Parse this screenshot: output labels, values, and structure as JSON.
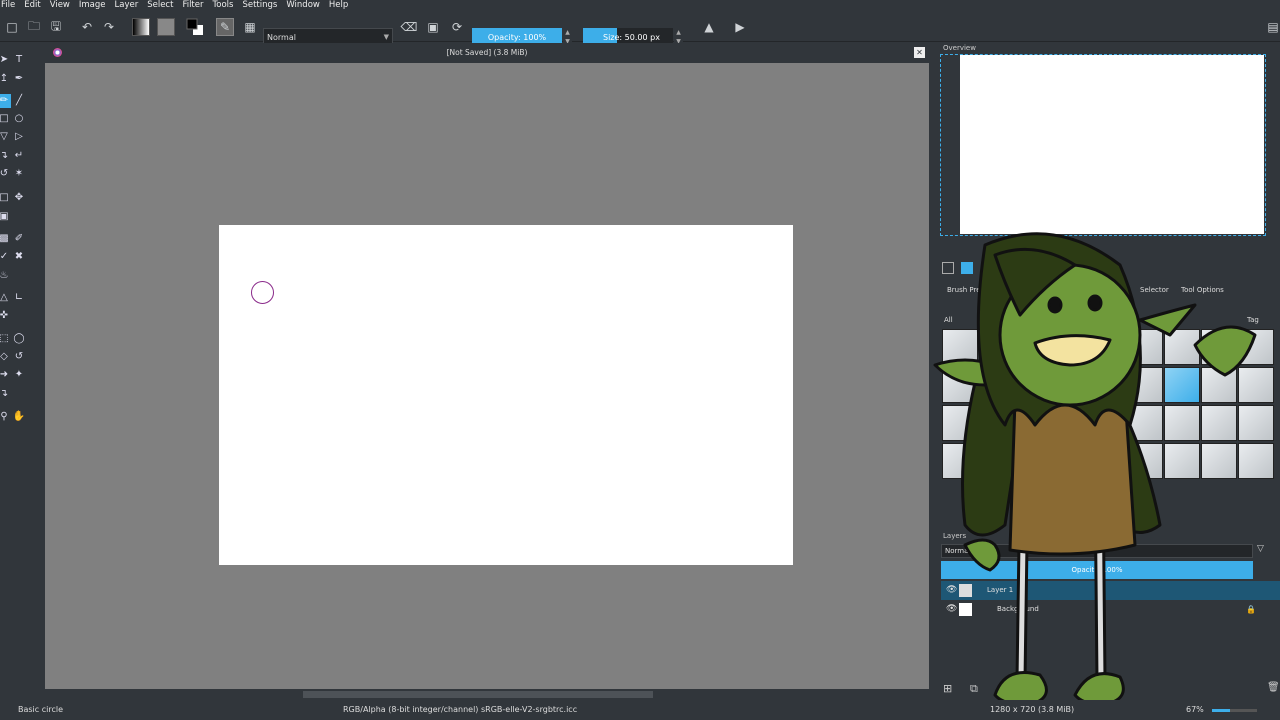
{
  "menu": [
    "File",
    "Edit",
    "View",
    "Image",
    "Layer",
    "Select",
    "Filter",
    "Tools",
    "Settings",
    "Window",
    "Help"
  ],
  "toolbar": {
    "blend_mode": "Normal",
    "opacity_label": "Opacity:  100%",
    "opacity_value": 1.0,
    "size_label": "Size:",
    "size_value": "50.00 px",
    "size_fraction": 0.38
  },
  "document": {
    "title": "[Not Saved]  (3.8 MiB)"
  },
  "overview": {
    "title": "Overview"
  },
  "brush_panel": {
    "tabs": [
      "Brush Presets",
      "Selector",
      "Tool Options"
    ],
    "filter": "All",
    "tag_label": "Tag"
  },
  "layers": {
    "title": "Layers",
    "blend_mode": "Normal",
    "opacity_label": "Opacity:  100%",
    "items": [
      {
        "name": "Layer 1",
        "selected": true
      },
      {
        "name": "Background",
        "selected": false
      }
    ]
  },
  "status": {
    "brush": "Basic circle",
    "color_info": "RGB/Alpha (8-bit integer/channel)  sRGB-elle-V2-srgbtrc.icc",
    "doc_info": "1280 x 720 (3.8 MiB)",
    "zoom": "67%"
  },
  "colors": {
    "accent": "#3daee9",
    "bg": "#31363b",
    "canvas_bg": "#808080"
  }
}
